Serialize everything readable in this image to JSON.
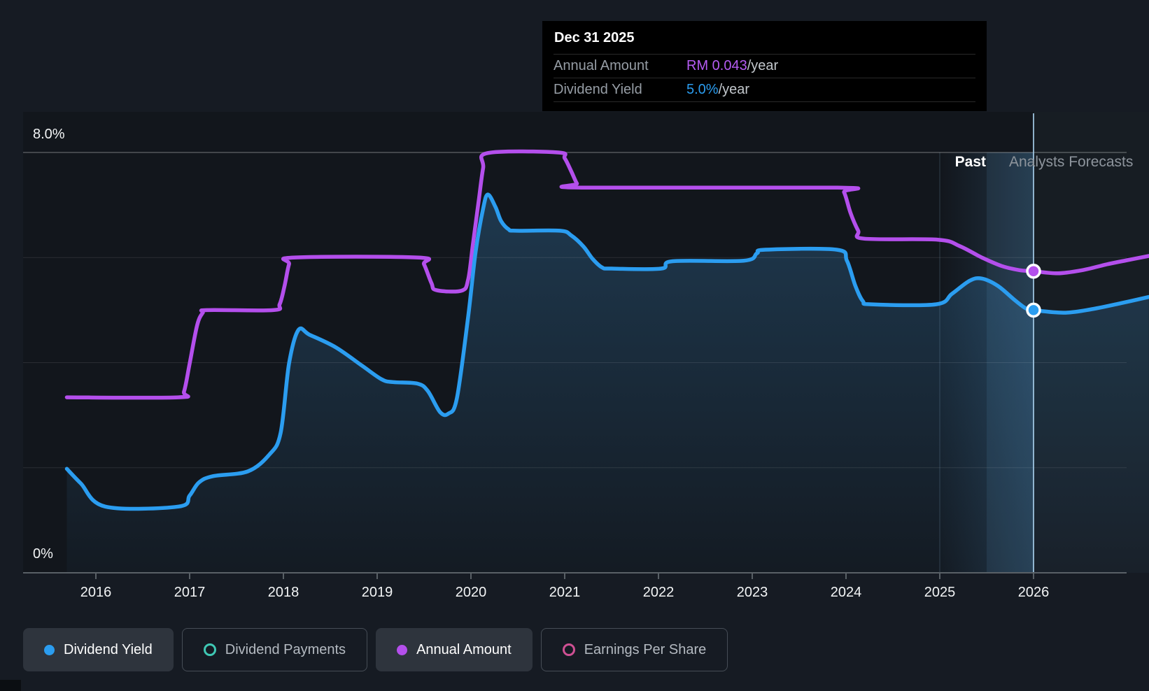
{
  "tooltip": {
    "date": "Dec 31 2025",
    "rows": [
      {
        "label": "Annual Amount",
        "value": "RM 0.043",
        "suffix": "/year",
        "value_color": "#b55cf3"
      },
      {
        "label": "Dividend Yield",
        "value": "5.0%",
        "suffix": "/year",
        "value_color": "#2b9df0"
      }
    ]
  },
  "annotations": {
    "past_label": "Past",
    "forecast_label": "Analysts Forecasts"
  },
  "legend": [
    {
      "label": "Dividend Yield",
      "color": "#2b9df0",
      "style": "filled",
      "active": true
    },
    {
      "label": "Dividend Payments",
      "color": "#3fc8b4",
      "style": "ring",
      "active": false
    },
    {
      "label": "Annual Amount",
      "color": "#b44fec",
      "style": "filled",
      "active": true
    },
    {
      "label": "Earnings Per Share",
      "color": "#cf5093",
      "style": "ring",
      "active": false
    }
  ],
  "chart_data": {
    "type": "line",
    "x_ticks": [
      2016,
      2017,
      2018,
      2019,
      2020,
      2021,
      2022,
      2023,
      2024,
      2025,
      2026
    ],
    "y_ticks": [
      {
        "pct": 8,
        "label": "8.0%"
      },
      {
        "pct": 0,
        "label": "0%"
      }
    ],
    "gridlines_pct": [
      8,
      6,
      4,
      2
    ],
    "y_axis_range": [
      0,
      8
    ],
    "x_axis_range": [
      2015.69,
      2027.23
    ],
    "band_start_year": 2025,
    "divider_year": 2026,
    "divider_date": "Dec 31 2025",
    "legend_position": "bottom",
    "series": [
      {
        "name": "Dividend Yield",
        "color": "#2b9df0",
        "unit": "percent_per_year",
        "fill_area": true,
        "marker_year": 2026,
        "marker_value": 5.0,
        "points": [
          [
            2015.69,
            1.98
          ],
          [
            2015.84,
            1.7
          ],
          [
            2016.1,
            1.26
          ],
          [
            2016.88,
            1.26
          ],
          [
            2017.0,
            1.47
          ],
          [
            2017.1,
            1.72
          ],
          [
            2017.25,
            1.84
          ],
          [
            2017.62,
            1.93
          ],
          [
            2017.85,
            2.25
          ],
          [
            2017.97,
            2.66
          ],
          [
            2018.06,
            3.98
          ],
          [
            2018.16,
            4.62
          ],
          [
            2018.28,
            4.53
          ],
          [
            2018.56,
            4.29
          ],
          [
            2018.84,
            3.94
          ],
          [
            2019.05,
            3.68
          ],
          [
            2019.17,
            3.63
          ],
          [
            2019.43,
            3.6
          ],
          [
            2019.54,
            3.46
          ],
          [
            2019.67,
            3.06
          ],
          [
            2019.76,
            3.03
          ],
          [
            2019.85,
            3.32
          ],
          [
            2019.97,
            4.87
          ],
          [
            2020.05,
            6.11
          ],
          [
            2020.13,
            6.93
          ],
          [
            2020.18,
            7.2
          ],
          [
            2020.26,
            6.97
          ],
          [
            2020.32,
            6.7
          ],
          [
            2020.4,
            6.54
          ],
          [
            2020.48,
            6.51
          ],
          [
            2020.95,
            6.51
          ],
          [
            2021.07,
            6.42
          ],
          [
            2021.2,
            6.21
          ],
          [
            2021.3,
            5.97
          ],
          [
            2021.4,
            5.81
          ],
          [
            2021.5,
            5.79
          ],
          [
            2022.03,
            5.79
          ],
          [
            2022.15,
            5.93
          ],
          [
            2022.91,
            5.94
          ],
          [
            2023.05,
            6.08
          ],
          [
            2023.14,
            6.15
          ],
          [
            2023.9,
            6.15
          ],
          [
            2024.01,
            5.94
          ],
          [
            2024.1,
            5.46
          ],
          [
            2024.18,
            5.17
          ],
          [
            2024.27,
            5.11
          ],
          [
            2024.96,
            5.11
          ],
          [
            2025.13,
            5.31
          ],
          [
            2025.32,
            5.56
          ],
          [
            2025.45,
            5.6
          ],
          [
            2025.62,
            5.46
          ],
          [
            2025.8,
            5.19
          ],
          [
            2025.92,
            5.03
          ],
          [
            2026.0,
            5.0
          ],
          [
            2026.33,
            4.95
          ],
          [
            2026.63,
            5.02
          ],
          [
            2026.93,
            5.13
          ],
          [
            2027.23,
            5.25
          ]
        ]
      },
      {
        "name": "Annual Amount",
        "color": "#b44fec",
        "unit": "axis_position_on_yield_scale (RM value shown in tooltip: RM 0.043/year at Dec 31 2025)",
        "fill_area": false,
        "marker_year": 2026,
        "marker_value": 5.74,
        "points": [
          [
            2015.69,
            3.34
          ],
          [
            2016.88,
            3.34
          ],
          [
            2016.94,
            3.45
          ],
          [
            2017.0,
            3.98
          ],
          [
            2017.08,
            4.71
          ],
          [
            2017.14,
            4.95
          ],
          [
            2017.19,
            5.0
          ],
          [
            2017.89,
            5.0
          ],
          [
            2017.96,
            5.11
          ],
          [
            2018.01,
            5.44
          ],
          [
            2018.06,
            5.87
          ],
          [
            2018.11,
            6.0
          ],
          [
            2019.44,
            6.0
          ],
          [
            2019.5,
            5.87
          ],
          [
            2019.58,
            5.51
          ],
          [
            2019.63,
            5.38
          ],
          [
            2019.9,
            5.37
          ],
          [
            2019.97,
            5.58
          ],
          [
            2020.02,
            6.24
          ],
          [
            2020.08,
            7.04
          ],
          [
            2020.13,
            7.7
          ],
          [
            2020.18,
            7.99
          ],
          [
            2020.93,
            8.0
          ],
          [
            2021.0,
            7.89
          ],
          [
            2021.07,
            7.64
          ],
          [
            2021.13,
            7.41
          ],
          [
            2021.18,
            7.33
          ],
          [
            2023.91,
            7.33
          ],
          [
            2023.98,
            7.24
          ],
          [
            2024.05,
            6.84
          ],
          [
            2024.13,
            6.51
          ],
          [
            2024.19,
            6.36
          ],
          [
            2024.98,
            6.34
          ],
          [
            2025.21,
            6.22
          ],
          [
            2025.45,
            6.0
          ],
          [
            2025.66,
            5.84
          ],
          [
            2025.85,
            5.76
          ],
          [
            2026.0,
            5.74
          ],
          [
            2026.26,
            5.7
          ],
          [
            2026.52,
            5.76
          ],
          [
            2026.78,
            5.87
          ],
          [
            2027.0,
            5.95
          ],
          [
            2027.23,
            6.03
          ]
        ]
      }
    ]
  },
  "colors": {
    "background": "#161b23",
    "grid_bright": "rgba(255,255,255,0.28)",
    "grid_faint": "rgba(255,255,255,0.10)",
    "axis": "#596066",
    "divider": "rgba(165,203,231,0.85)",
    "band_tint": "rgba(80,150,205,0.22)"
  }
}
